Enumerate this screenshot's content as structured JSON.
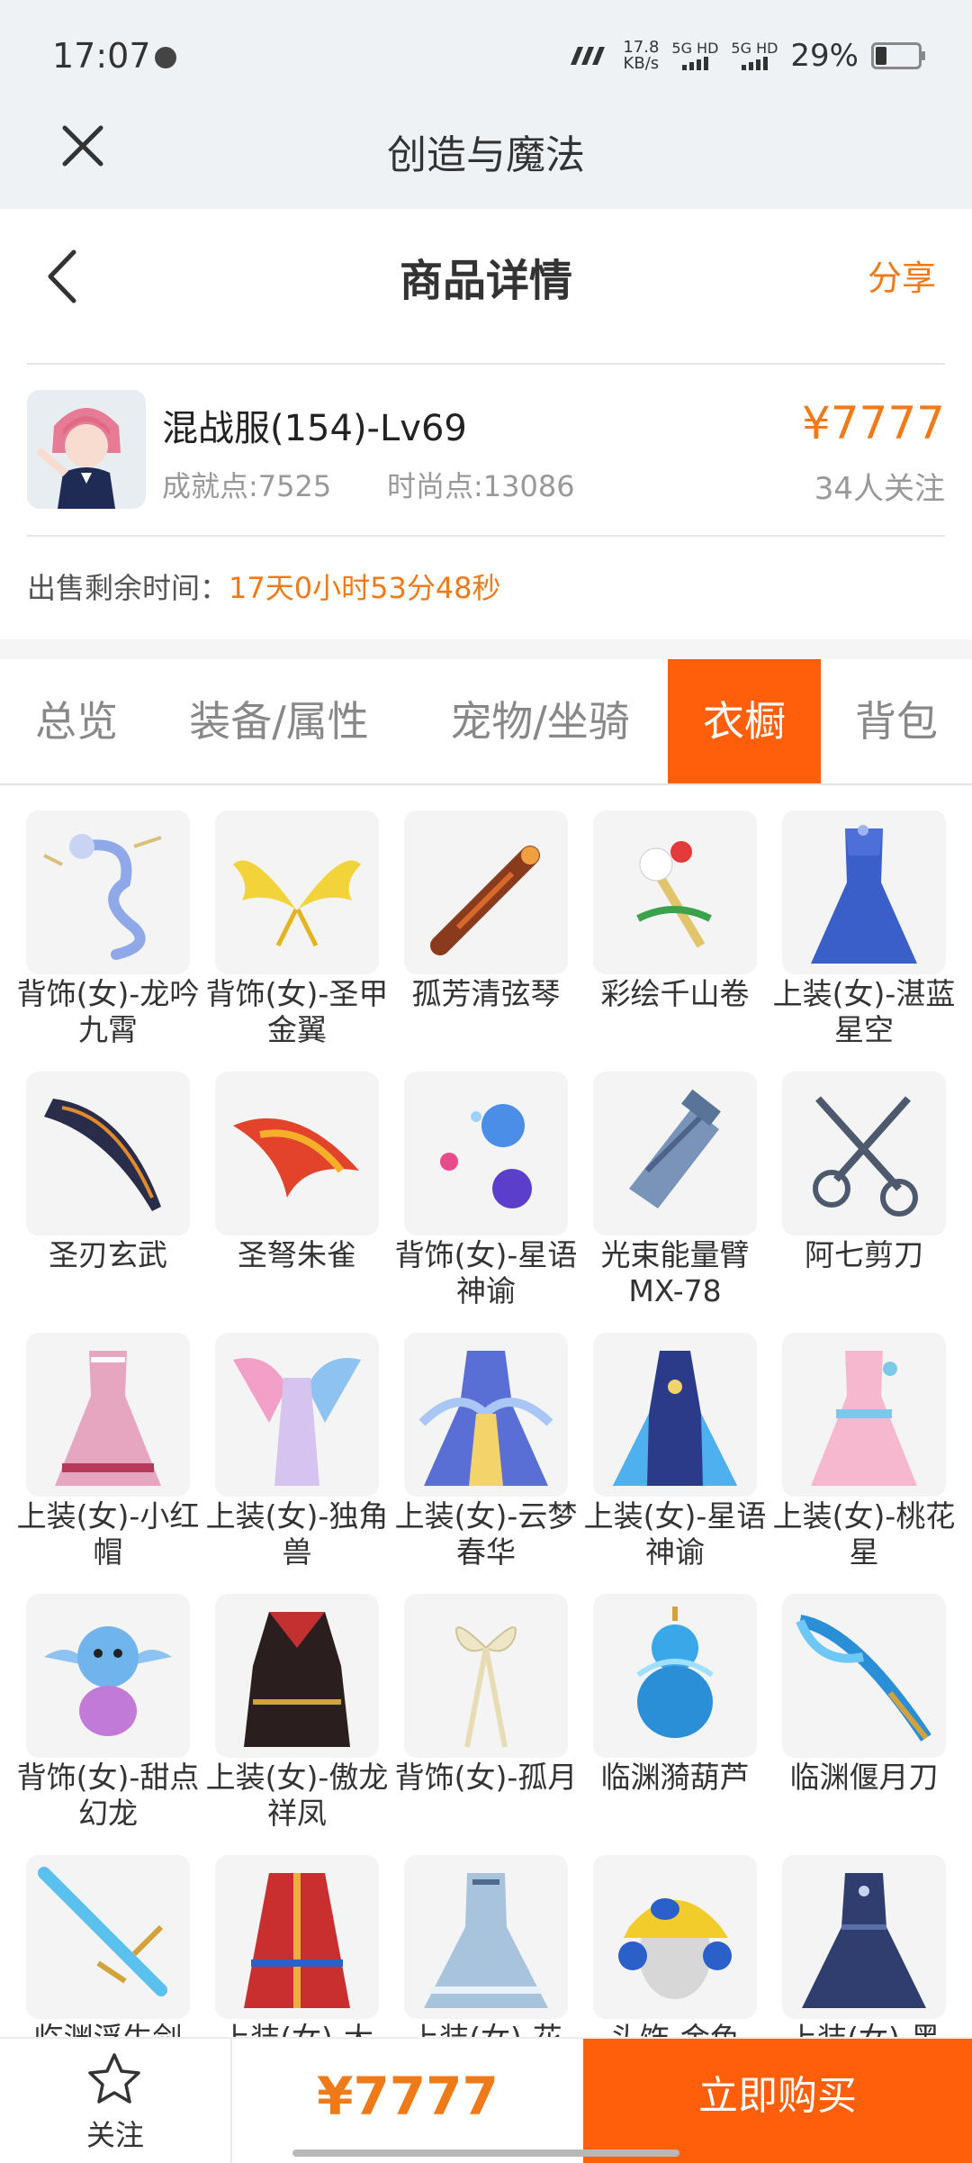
{
  "status_bar": {
    "time": "17:07",
    "net_speed_value": "17.8",
    "net_speed_unit": "KB/s",
    "sim1_label": "5G HD",
    "sim2_label": "5G HD",
    "battery": "29%"
  },
  "app_header": {
    "title": "创造与魔法",
    "close_icon": "close-icon"
  },
  "detail_header": {
    "title": "商品详情",
    "share_label": "分享",
    "back_icon": "chevron-left-icon"
  },
  "listing": {
    "server": "混战服(154)-Lv69",
    "achievement": "成就点:7525",
    "fashion": "时尚点:13086",
    "price": "¥7777",
    "followers": "34人关注",
    "remaining_label": "出售剩余时间：",
    "remaining_time": "17天0小时53分48秒"
  },
  "tabs": [
    {
      "label": "总览",
      "active": false
    },
    {
      "label": "装备/属性",
      "active": false
    },
    {
      "label": "宠物/坐骑",
      "active": false
    },
    {
      "label": "衣橱",
      "active": true
    },
    {
      "label": "背包",
      "active": false
    }
  ],
  "items": [
    {
      "name": "背饰(女)-龙吟九霄",
      "icon": "dragon-back-icon"
    },
    {
      "name": "背饰(女)-圣甲金翼",
      "icon": "golden-wings-icon"
    },
    {
      "name": "孤芳清弦琴",
      "icon": "lute-icon"
    },
    {
      "name": "彩绘千山卷",
      "icon": "scroll-icon"
    },
    {
      "name": "上装(女)-湛蓝星空",
      "icon": "blue-dress-icon"
    },
    {
      "name": "圣刃玄武",
      "icon": "dark-blade-icon"
    },
    {
      "name": "圣弩朱雀",
      "icon": "phoenix-crossbow-icon"
    },
    {
      "name": "背饰(女)-星语神谕",
      "icon": "orbs-icon"
    },
    {
      "name": "光束能量臂MX-78",
      "icon": "arm-cannon-icon"
    },
    {
      "name": "阿七剪刀",
      "icon": "scissors-icon"
    },
    {
      "name": "上装(女)-小红帽",
      "icon": "pink-dress-icon"
    },
    {
      "name": "上装(女)-独角兽",
      "icon": "unicorn-outfit-icon"
    },
    {
      "name": "上装(女)-云梦春华",
      "icon": "cloud-dress-icon"
    },
    {
      "name": "上装(女)-星语神谕",
      "icon": "star-outfit-icon"
    },
    {
      "name": "上装(女)-桃花星",
      "icon": "peach-dress-icon"
    },
    {
      "name": "背饰(女)-甜点幻龙",
      "icon": "baby-dragon-icon"
    },
    {
      "name": "上装(女)-傲龙祥凤",
      "icon": "dragon-robe-icon"
    },
    {
      "name": "背饰(女)-孤月",
      "icon": "ribbon-icon"
    },
    {
      "name": "临渊漪葫芦",
      "icon": "water-gourd-icon"
    },
    {
      "name": "临渊偃月刀",
      "icon": "water-glaive-icon"
    },
    {
      "name": "临渊浮生剑",
      "icon": "water-sword-icon"
    },
    {
      "name": "上装(女)-大",
      "icon": "red-robe-icon"
    },
    {
      "name": "上装(女)-花",
      "icon": "lace-dress-icon"
    },
    {
      "name": "头饰-金色",
      "icon": "cap-headphones-icon"
    },
    {
      "name": "上装(女)-黑",
      "icon": "navy-gown-icon"
    }
  ],
  "bottom_bar": {
    "follow_label": "关注",
    "price": "¥7777",
    "buy_label": "立即购买"
  },
  "colors": {
    "accent": "#ff5e0b",
    "price": "#f07a18",
    "header_bg": "#eef2f5"
  }
}
